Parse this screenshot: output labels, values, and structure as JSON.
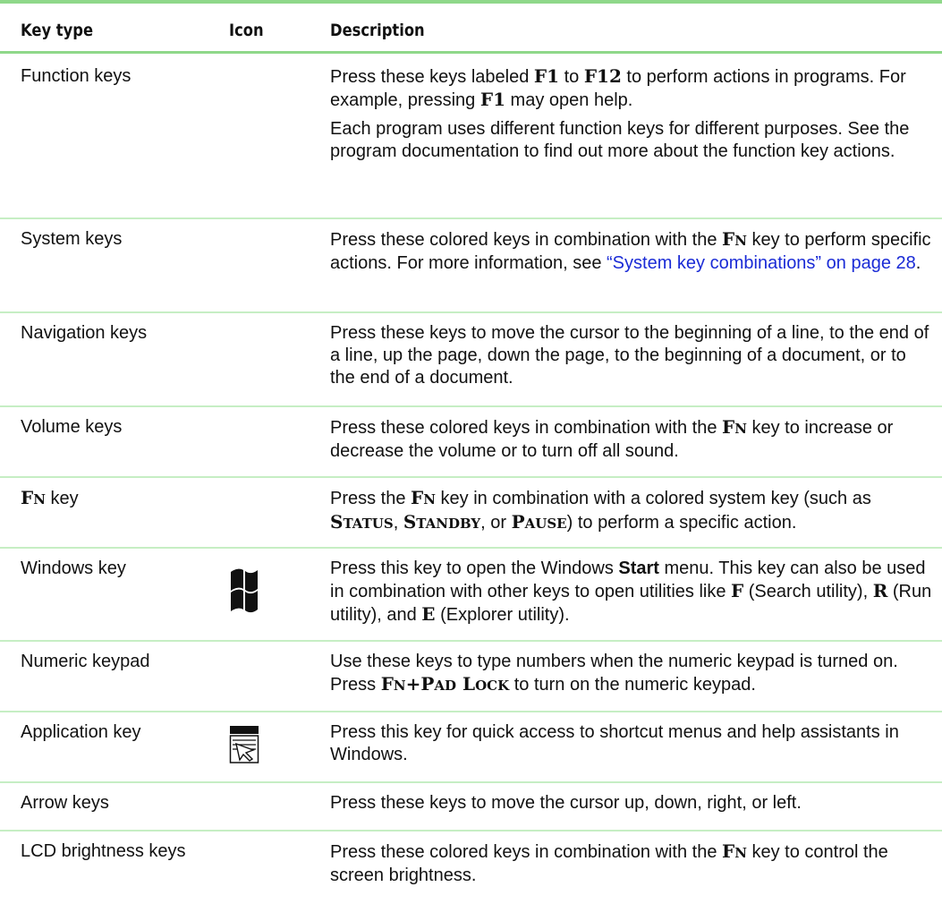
{
  "header": {
    "key_type": "Key type",
    "icon": "Icon",
    "description": "Description"
  },
  "rows": [
    {
      "key": "Function keys",
      "d1a": "Press these keys labeled ",
      "d1k1": "F1",
      "d1b": " to ",
      "d1k2": "F12",
      "d1c": " to perform actions in programs. For example, pressing ",
      "d1k3": "F1",
      "d1d": " may open help.",
      "d2": "Each program uses different function keys for different purposes. See the program documentation to find out more about the function key actions."
    },
    {
      "key": "System keys",
      "d1a": "Press these colored keys in combination with the ",
      "fn_f": "F",
      "fn_n": "N",
      "d1b": " key to perform specific actions. For more information, see ",
      "link": "“System key combinations” on page 28",
      "d1c": "."
    },
    {
      "key": "Navigation keys",
      "d1": "Press these keys to move the cursor to the beginning of a line, to the end of a line, up the page, down the page, to the beginning of a document, or to the end of a document."
    },
    {
      "key": "Volume keys",
      "d1a": "Press these colored keys in combination with the ",
      "fn_f": "F",
      "fn_n": "N",
      "d1b": " key to increase or decrease the volume or to turn off all sound."
    },
    {
      "key_f": "F",
      "key_n": "N",
      "key_rest": " key",
      "d1a": "Press the ",
      "fn_f": "F",
      "fn_n": "N",
      "d1b": " key in combination with a colored system key (such as ",
      "s1_cap": "S",
      "s1_sc": "TATUS",
      "comma1": ", ",
      "s2_cap": "S",
      "s2_sc": "TANDBY",
      "or": ", or ",
      "s3_cap": "P",
      "s3_sc": "AUSE",
      "d1c": ") to perform a specific action."
    },
    {
      "key": "Windows key",
      "icon": "windows-logo-icon",
      "d1a": "Press this key to open the Windows ",
      "start": "Start",
      "d1b": " menu. This key can also be used in combination with other keys to open utilities like ",
      "kf": "F",
      "d1c": " (Search utility), ",
      "kr": "R",
      "d1d": " (Run utility), and ",
      "ke": "E",
      "d1e": " (Explorer utility)."
    },
    {
      "key": "Numeric keypad",
      "d1a": "Use these keys to type numbers when the numeric keypad is turned on. Press ",
      "fn_f": "F",
      "fn_n": "N",
      "plus": "+",
      "p_cap": "P",
      "p_sc": "AD",
      "l_cap": "L",
      "l_sc": "OCK",
      "d1b": " to turn on the numeric keypad."
    },
    {
      "key": "Application key",
      "icon": "application-menu-icon",
      "d1": "Press this key for quick access to shortcut menus and help assistants in Windows."
    },
    {
      "key": "Arrow keys",
      "d1": "Press these keys to move the cursor up, down, right, or left."
    },
    {
      "key": "LCD brightness keys",
      "d1a": "Press these colored keys in combination with the ",
      "fn_f": "F",
      "fn_n": "N",
      "d1b": " key to control the screen brightness."
    }
  ],
  "colors": {
    "rule": "#8fd88a",
    "separator": "#c6eec4",
    "link": "#1a2bd6"
  }
}
